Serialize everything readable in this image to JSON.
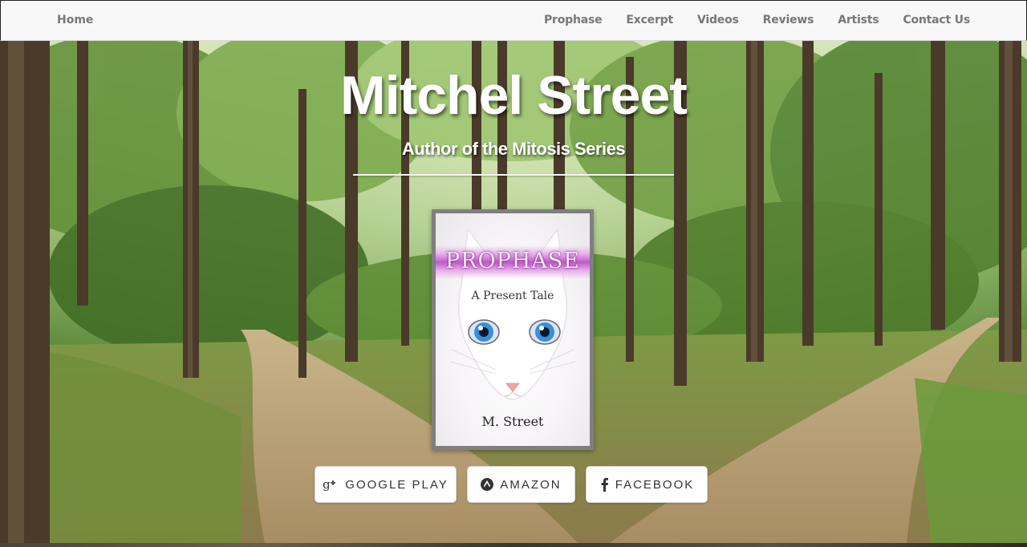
{
  "nav": {
    "home": "Home",
    "links": [
      "Prophase",
      "Excerpt",
      "Videos",
      "Reviews",
      "Artists",
      "Contact Us"
    ]
  },
  "hero": {
    "title": "Mitchel Street",
    "subtitle": "Author of the Mitosis Series"
  },
  "book": {
    "title": "PROPHASE",
    "tagline": "A Present Tale",
    "author": "M. Street"
  },
  "buttons": {
    "google": {
      "label": "GOOGLE PLAY",
      "icon": "google-plus-icon"
    },
    "amazon": {
      "label": "AMAZON",
      "icon": "amazon-icon"
    },
    "facebook": {
      "label": "FACEBOOK",
      "icon": "facebook-icon"
    }
  },
  "colors": {
    "nav_background": "#f8f8f8",
    "nav_text": "#777777",
    "hero_text": "#ffffff",
    "button_background": "#ffffff",
    "book_frame": "#7f7f7f",
    "book_band": "#c05ac8",
    "cat_eye": "#3a8fd8"
  }
}
